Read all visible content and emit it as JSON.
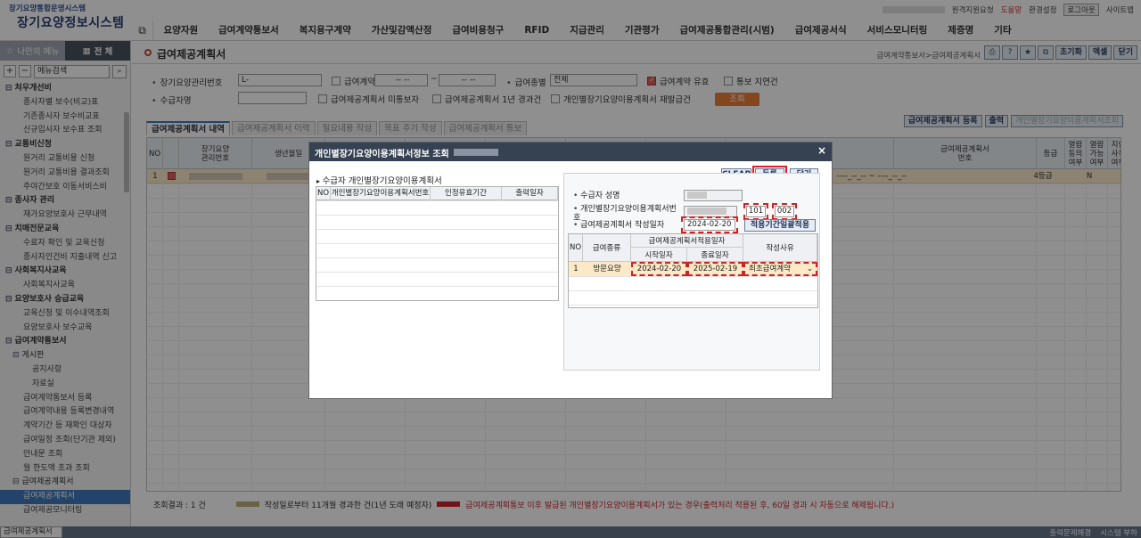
{
  "header": {
    "system_subtitle": "장기요양통합운영시스템",
    "system_title": "장기요양정보시스템",
    "util": {
      "remote": "원격지원요청",
      "help": "도움말",
      "env": "환경설정",
      "logout": "로그아웃",
      "sitemap": "사이트맵"
    },
    "nav": [
      "요양자원",
      "급여계약통보서",
      "복지용구계약",
      "가산및감액산정",
      "급여비용청구",
      "RFID",
      "지급관리",
      "기관평가",
      "급여제공통합관리(시범)",
      "급여제공서식",
      "서비스모니터링",
      "제증명",
      "기타"
    ]
  },
  "sidebar": {
    "tab_my": "나만의 메뉴",
    "tab_all": "전 체",
    "search_placeholder": "메뉴검색",
    "items": [
      {
        "label": "처우개선비",
        "level": "g"
      },
      {
        "label": "종사자별 보수(비교)표",
        "level": "s"
      },
      {
        "label": "기존종사자 보수비교표",
        "level": "s"
      },
      {
        "label": "신규입사자 보수표 조회",
        "level": "s"
      },
      {
        "label": "교통비신청",
        "level": "g"
      },
      {
        "label": "원거리 교통비용 신청",
        "level": "s"
      },
      {
        "label": "원거리 교통비용 결과조회",
        "level": "s"
      },
      {
        "label": "주야간보호 이동서비스비",
        "level": "s"
      },
      {
        "label": "종사자 관리",
        "level": "g"
      },
      {
        "label": "재가요양보호사 근무내역",
        "level": "s"
      },
      {
        "label": "치매전문교육",
        "level": "g"
      },
      {
        "label": "수료자 확인 및 교육신청",
        "level": "s"
      },
      {
        "label": "종사자인건비 지출내역 신고",
        "level": "s"
      },
      {
        "label": "사회복지사교육",
        "level": "g"
      },
      {
        "label": "사회복지사교육",
        "level": "s"
      },
      {
        "label": "요양보호사 승급교육",
        "level": "g"
      },
      {
        "label": "교육신청 및 이수내역조회",
        "level": "s"
      },
      {
        "label": "요양보호사 보수교육",
        "level": "s"
      },
      {
        "label": "급여계약통보서",
        "level": "g"
      },
      {
        "label": "게시판",
        "level": "sg"
      },
      {
        "label": "공지사항",
        "level": "s2"
      },
      {
        "label": "자료실",
        "level": "s2"
      },
      {
        "label": "급여계약통보서 등록",
        "level": "s"
      },
      {
        "label": "급여계약내용 등록변경내역",
        "level": "s"
      },
      {
        "label": "계약기간 등 재확인 대상자",
        "level": "s"
      },
      {
        "label": "급여일정 조회(단기관 제외)",
        "level": "s"
      },
      {
        "label": "안내문 조회",
        "level": "s"
      },
      {
        "label": "월 한도액 초과 조회",
        "level": "s"
      },
      {
        "label": "급여제공계획서",
        "level": "sg"
      },
      {
        "label": "급여제공계획서",
        "level": "s",
        "active": true
      },
      {
        "label": "급여제공모니터링",
        "level": "s"
      }
    ]
  },
  "page": {
    "title": "급여제공계획서",
    "breadcrumb": "급여계약통보서>급여제공계획서",
    "toolbar": {
      "reset": "초기화",
      "excel": "엑셀",
      "print": "닫기"
    }
  },
  "filter": {
    "ltc_no_label": "장기요양관리번호",
    "ltc_no_value": "L-",
    "contract_date_label": "급여계약일",
    "date_from": "-- --",
    "date_sep": "~",
    "date_to": "-- --",
    "benefit_type_label": "급여종별",
    "benefit_type_value": "전체",
    "valid_contract_label": "급여계약 유효",
    "late_notice_label": "통보 지연건",
    "recipient_label": "수급자명",
    "unnotified_label": "급여제공계획서 미통보자",
    "over_year_label": "급여제공계획서 1년 경과건",
    "reissue_label": "개인별장기요양이용계획서 재발급건",
    "search_button": "조회"
  },
  "tabs": [
    "급여제공계획서 내역",
    "급여제공계획서 이력",
    "필요내용 작성",
    "목표 주기 작성",
    "급여제공계획서 통보"
  ],
  "right_buttons": {
    "register": "급여제공계획서 등록",
    "output": "출력",
    "query": "개인별장기요양이용계획서조회"
  },
  "grid": {
    "headers": [
      "NO",
      "",
      "장기요양\n관리번호",
      "생년월일",
      "",
      "",
      "",
      "",
      "",
      "적용기간",
      "급여제공계획서\n번호",
      "등급",
      "열람\n동의\n여부",
      "열람\n가능\n여부",
      "지연\n사유\n여부"
    ],
    "row": {
      "no": "1",
      "period": "----_--_-- ~ ----_--_--",
      "grade": "4등급",
      "avail": "N"
    }
  },
  "footer": {
    "result_label": "조회결과 : 1 건",
    "legend1": "작성일로부터 11개월 경과한 건(1년 도래 예정자)",
    "legend2": "급여제공계획통보 이후 발급된 개인별장기요양이용계획서가 있는 경우(출력처리 적용된 후, 60일 경과 시 자동으로 해제됩니다.)",
    "legend1_color": "#b5ad6e",
    "legend2_color": "#c8141e",
    "status_tab": "급여제공계획서",
    "status_right1": "출력문제해결",
    "status_right2": "시스템 부하"
  },
  "modal": {
    "title": "개인별장기요양이용계획서정보 조회",
    "close": "×",
    "left_title": "수급자 개인별장기요양이용계획서",
    "left_headers": [
      "NO",
      "개인별장기요양이용계획서번호",
      "인정유효기간",
      "출력일자"
    ],
    "buttons": {
      "clear": "CLEAR",
      "register": "등록",
      "close": "닫기"
    },
    "recipient_name_label": "수급자 성명",
    "plan_no_label": "개인별장기요양이용계획서번호",
    "plan_no_part2": "101",
    "plan_no_part3": "002",
    "write_date_label": "급여제공계획서 작성일자",
    "write_date_value": "2024-02-20",
    "apply_all_button": "적용기간일괄적용",
    "table_headers": {
      "no": "NO",
      "type": "급여종류",
      "period": "급여제공계획서적용일자",
      "start": "시작일자",
      "end": "종료일자",
      "reason": "작성사유"
    },
    "row": {
      "no": "1",
      "type": "방문요양",
      "start": "2024-02-20",
      "end": "2025-02-19",
      "reason": "최초급여계약"
    }
  }
}
